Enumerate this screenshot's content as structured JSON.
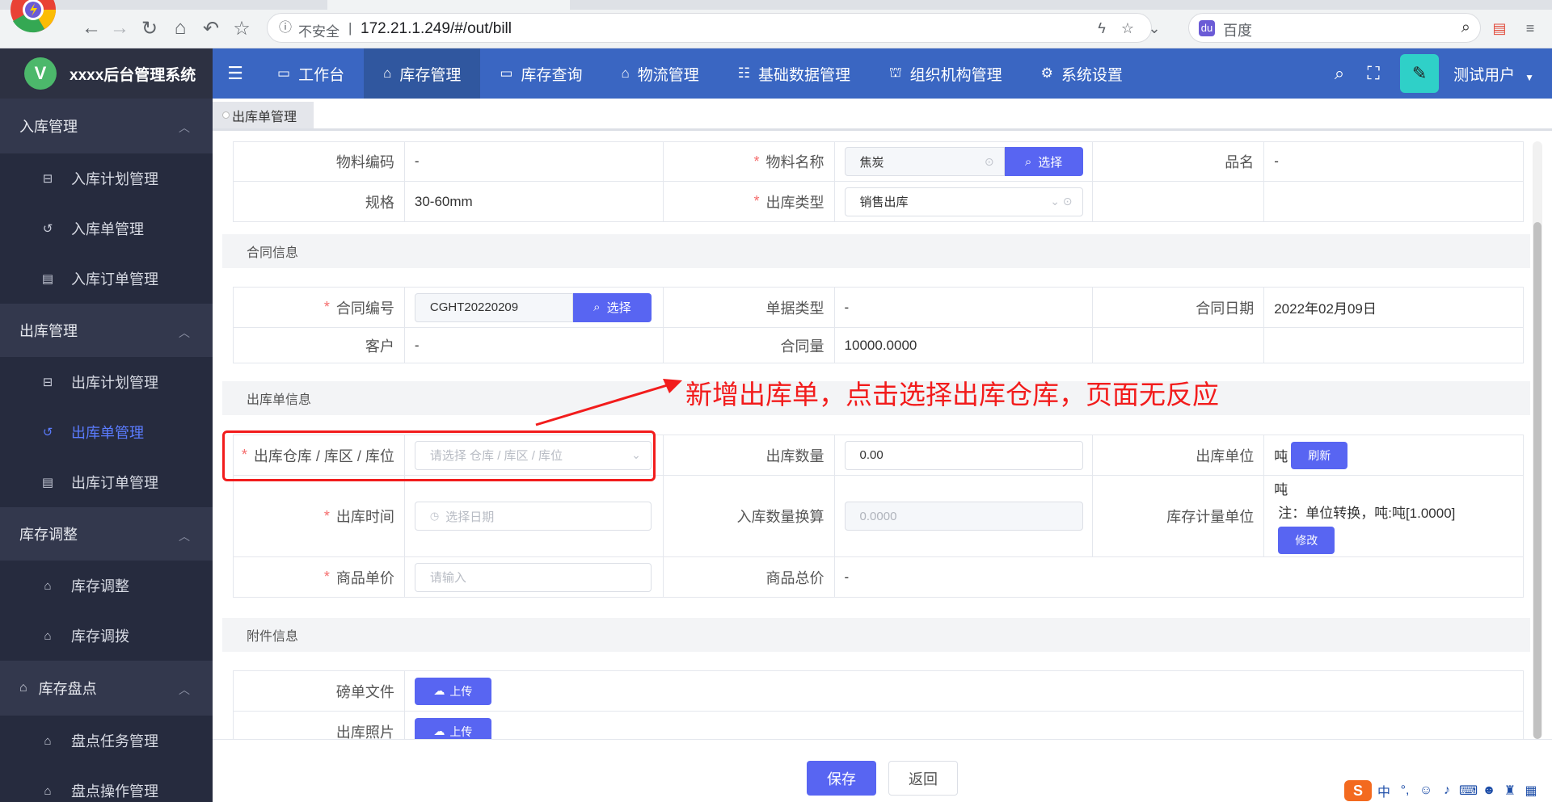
{
  "browser": {
    "insecure_label": "不安全",
    "separator": "|",
    "url": "172.21.1.249/#/out/bill",
    "search_placeholder": "百度",
    "baidu_glyph": "du"
  },
  "app": {
    "logo_letter": "V",
    "title": "xxxx后台管理系统"
  },
  "sidebar": {
    "groups": [
      {
        "label": "入库管理",
        "items": [
          "入库计划管理",
          "入库单管理",
          "入库订单管理"
        ]
      },
      {
        "label": "出库管理",
        "items": [
          "出库计划管理",
          "出库单管理",
          "出库订单管理"
        ],
        "active_item": "出库单管理"
      },
      {
        "label": "库存调整",
        "items": [
          "库存调整",
          "库存调拨"
        ]
      },
      {
        "label": "库存盘点",
        "items": [
          "盘点任务管理",
          "盘点操作管理"
        ]
      }
    ]
  },
  "topnav": {
    "items": [
      "工作台",
      "库存管理",
      "库存查询",
      "物流管理",
      "基础数据管理",
      "组织机构管理",
      "系统设置"
    ],
    "active": "库存管理",
    "user": "测试用户"
  },
  "tabs": {
    "current": "出库单管理"
  },
  "material": {
    "code_label": "物料编码",
    "code_value": "-",
    "name_label": "物料名称",
    "name_value": "焦炭",
    "select_label": "选择",
    "pinming_label": "品名",
    "pinming_value": "-",
    "spec_label": "规格",
    "spec_value": "30-60mm",
    "out_type_label": "出库类型",
    "out_type_value": "销售出库"
  },
  "contract": {
    "section_title": "合同信息",
    "no_label": "合同编号",
    "no_value": "CGHT20220209",
    "select_label": "选择",
    "doc_type_label": "单据类型",
    "doc_type_value": "-",
    "date_label": "合同日期",
    "date_value": "2022年02月09日",
    "customer_label": "客户",
    "customer_value": "-",
    "qty_label": "合同量",
    "qty_value": "10000.0000"
  },
  "outbill": {
    "section_title": "出库单信息",
    "warehouse_label": "出库仓库 / 库区 / 库位",
    "warehouse_placeholder": "请选择 仓库 / 库区 / 库位",
    "qty_label": "出库数量",
    "qty_value": "0.00",
    "unit_label": "出库单位",
    "unit_value": "吨",
    "refresh_label": "刷新",
    "time_label": "出库时间",
    "time_placeholder": "选择日期",
    "conv_label": "入库数量换算",
    "conv_value": "0.0000",
    "stock_unit_label": "库存计量单位",
    "stock_unit_value": "吨",
    "stock_unit_note": "注：单位转换，吨:吨[1.0000]",
    "modify_label": "修改",
    "price_label": "商品单价",
    "price_placeholder": "请输入",
    "total_label": "商品总价",
    "total_value": "-"
  },
  "attachment": {
    "section_title": "附件信息",
    "weigh_label": "磅单文件",
    "photo_label": "出库照片",
    "upload_label": "上传"
  },
  "annotation": {
    "text": "新增出库单，点击选择出库仓库，页面无反应"
  },
  "footer": {
    "save_label": "保存",
    "back_label": "返回"
  },
  "ime": {
    "logo": "S",
    "lang": "中"
  },
  "colors": {
    "primary": "#5865f2",
    "topnav": "#3a66c2",
    "sidebar": "#262b3e",
    "annotation": "#f21c1c",
    "required": "#f56c6c"
  }
}
